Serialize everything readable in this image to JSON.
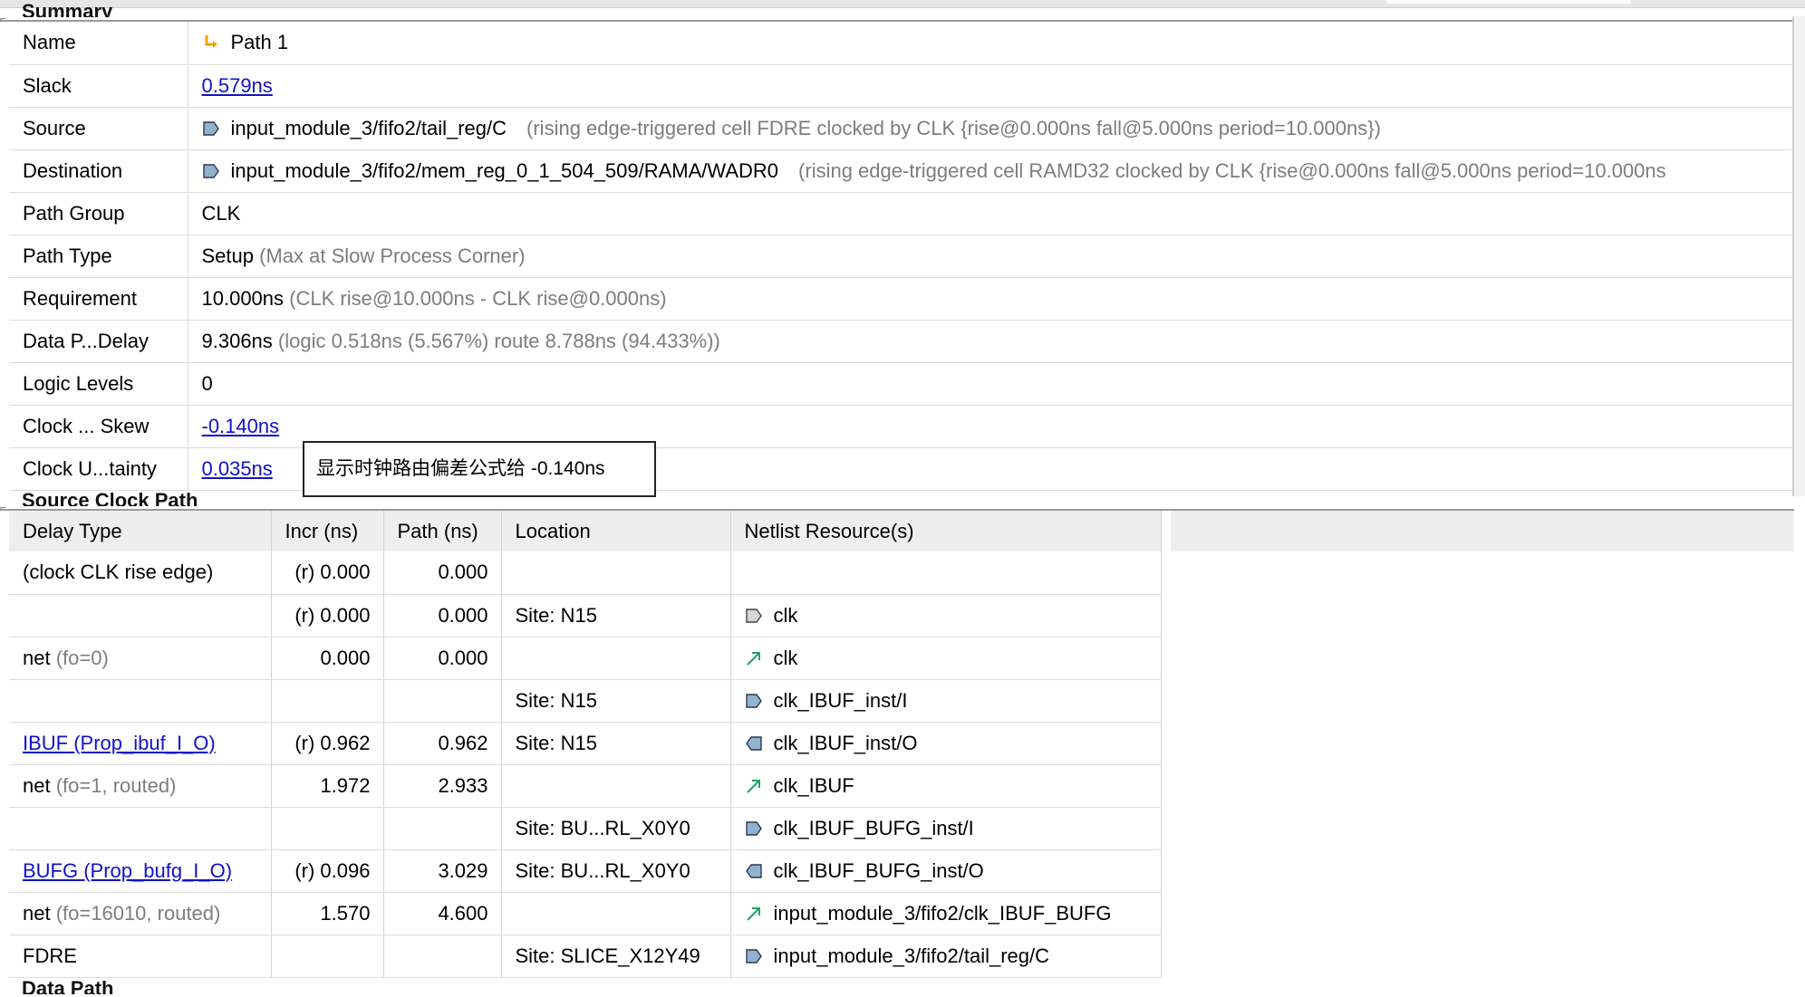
{
  "sections": {
    "summary": "Summary",
    "source_clock": "Source Clock Path",
    "data_path": "Data Path"
  },
  "summary_rows": [
    {
      "key": "Name",
      "main": "Path 1",
      "extra": "",
      "kind": "name"
    },
    {
      "key": "Slack",
      "main": "0.579ns",
      "extra": "",
      "kind": "link"
    },
    {
      "key": "Source",
      "main": "input_module_3/fifo2/tail_reg/C",
      "extra": "(rising edge-triggered cell FDRE clocked by CLK  {rise@0.000ns fall@5.000ns period=10.000ns})",
      "kind": "pin"
    },
    {
      "key": "Destination",
      "main": "input_module_3/fifo2/mem_reg_0_1_504_509/RAMA/WADR0",
      "extra": "(rising edge-triggered cell RAMD32 clocked by CLK  {rise@0.000ns fall@5.000ns period=10.000ns",
      "kind": "pin"
    },
    {
      "key": "Path Group",
      "main": "CLK",
      "extra": "",
      "kind": "text"
    },
    {
      "key": "Path Type",
      "main": "Setup",
      "extra": "(Max at Slow Process Corner)",
      "kind": "text"
    },
    {
      "key": "Requirement",
      "main": "10.000ns",
      "extra": "(CLK rise@10.000ns - CLK rise@0.000ns)",
      "kind": "text"
    },
    {
      "key": "Data P...Delay",
      "main": "9.306ns",
      "extra": "(logic 0.518ns (5.567%)  route 8.788ns (94.433%))",
      "kind": "text"
    },
    {
      "key": "Logic Levels",
      "main": "0",
      "extra": "",
      "kind": "text"
    },
    {
      "key": "Clock ... Skew",
      "main": "-0.140ns",
      "extra": "",
      "kind": "link"
    },
    {
      "key": "Clock U...tainty",
      "main": "0.035ns",
      "extra": "",
      "kind": "link"
    }
  ],
  "tooltip": "显示时钟路由偏差公式给 -0.140ns",
  "clock_headers": [
    "Delay Type",
    "Incr (ns)",
    "Path (ns)",
    "Location",
    "Netlist Resource(s)"
  ],
  "clock_rows": [
    {
      "type": "(clock CLK rise edge)",
      "type_extra": "",
      "link": false,
      "incr": "(r) 0.000",
      "path": "0.000",
      "loc": "",
      "icon": "",
      "res": ""
    },
    {
      "type": "",
      "type_extra": "",
      "link": false,
      "incr": "(r) 0.000",
      "path": "0.000",
      "loc": "Site: N15",
      "icon": "port-icon",
      "res": "clk"
    },
    {
      "type": "net",
      "type_extra": "(fo=0)",
      "link": false,
      "incr": "0.000",
      "path": "0.000",
      "loc": "",
      "icon": "net-icon",
      "res": "clk"
    },
    {
      "type": "",
      "type_extra": "",
      "link": false,
      "incr": "",
      "path": "",
      "loc": "Site: N15",
      "icon": "input-pin-icon",
      "res": "clk_IBUF_inst/I"
    },
    {
      "type": "IBUF (Prop_ibuf_I_O)",
      "type_extra": "",
      "link": true,
      "incr": "(r) 0.962",
      "path": "0.962",
      "loc": "Site: N15",
      "icon": "output-pin-icon",
      "res": "clk_IBUF_inst/O"
    },
    {
      "type": "net",
      "type_extra": "(fo=1, routed)",
      "link": false,
      "incr": "1.972",
      "path": "2.933",
      "loc": "",
      "icon": "net-icon",
      "res": "clk_IBUF"
    },
    {
      "type": "",
      "type_extra": "",
      "link": false,
      "incr": "",
      "path": "",
      "loc": "Site: BU...RL_X0Y0",
      "icon": "input-pin-icon",
      "res": "clk_IBUF_BUFG_inst/I"
    },
    {
      "type": "BUFG (Prop_bufg_I_O)",
      "type_extra": "",
      "link": true,
      "incr": "(r) 0.096",
      "path": "3.029",
      "loc": "Site: BU...RL_X0Y0",
      "icon": "output-pin-icon",
      "res": "clk_IBUF_BUFG_inst/O"
    },
    {
      "type": "net",
      "type_extra": "(fo=16010, routed)",
      "link": false,
      "incr": "1.570",
      "path": "4.600",
      "loc": "",
      "icon": "net-icon",
      "res": "input_module_3/fifo2/clk_IBUF_BUFG"
    },
    {
      "type": "FDRE",
      "type_extra": "",
      "link": false,
      "incr": "",
      "path": "",
      "loc": "Site: SLICE_X12Y49",
      "icon": "input-pin-icon",
      "res": "input_module_3/fifo2/tail_reg/C"
    }
  ],
  "colors": {
    "link": "#1111cc",
    "pin_fill": "#8fb4cc",
    "net_green": "#21a366",
    "name_orange": "#f0a30a",
    "muted": "#7d7d7d"
  }
}
